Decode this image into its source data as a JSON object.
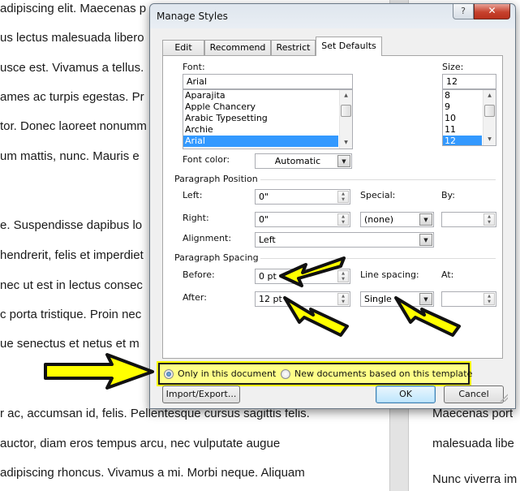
{
  "document": {
    "left_lines": [
      "adipiscing elit. Maecenas p",
      "us lectus malesuada libero",
      "usce est. Vivamus a tellus.",
      "ames ac turpis egestas. Pr",
      "tor. Donec laoreet nonumm",
      "um mattis, nunc. Mauris e",
      "e. Suspendisse dapibus lo",
      "hendrerit, felis et imperdiet",
      "nec ut est in lectus consec",
      "c porta tristique. Proin nec",
      "ue senectus et netus et m",
      "r ac, accumsan id, felis. Pellentesque cursus sagittis felis.",
      " auctor, diam eros tempus arcu, nec vulputate augue",
      " adipiscing rhoncus. Vivamus a mi. Morbi neque. Aliquam"
    ],
    "right_lines": [
      "Maecenas port",
      "malesuada libe",
      "Nunc viverra im"
    ]
  },
  "dialog": {
    "title": "Manage Styles",
    "help_label": "?",
    "close_label": "✕",
    "tabs": [
      {
        "label": "Edit",
        "active": false
      },
      {
        "label": "Recommend",
        "active": false
      },
      {
        "label": "Restrict",
        "active": false
      },
      {
        "label": "Set Defaults",
        "active": true
      }
    ],
    "font": {
      "label": "Font:",
      "value": "Arial",
      "options": [
        "Aparajita",
        "Apple Chancery",
        "Arabic Typesetting",
        "Archie",
        "Arial"
      ],
      "selected": "Arial"
    },
    "size": {
      "label": "Size:",
      "value": "12",
      "options": [
        "8",
        "9",
        "10",
        "11",
        "12"
      ],
      "selected": "12"
    },
    "font_color": {
      "label": "Font color:",
      "value": "Automatic"
    },
    "paragraph_position": {
      "heading": "Paragraph Position",
      "left_label": "Left:",
      "left_value": "0\"",
      "right_label": "Right:",
      "right_value": "0\"",
      "special_label": "Special:",
      "special_value": "(none)",
      "by_label": "By:",
      "by_value": "",
      "alignment_label": "Alignment:",
      "alignment_value": "Left"
    },
    "paragraph_spacing": {
      "heading": "Paragraph Spacing",
      "before_label": "Before:",
      "before_value": "0 pt",
      "after_label": "After:",
      "after_value": "12 pt",
      "line_spacing_label": "Line spacing:",
      "line_spacing_value": "Single",
      "at_label": "At:",
      "at_value": ""
    },
    "scope": {
      "option_document": "Only in this document",
      "option_template": "New documents based on this template",
      "selected": "Only in this document"
    },
    "buttons": {
      "import_export": "Import/Export...",
      "ok": "OK",
      "cancel": "Cancel"
    }
  },
  "annotation_color": "#ffff00"
}
